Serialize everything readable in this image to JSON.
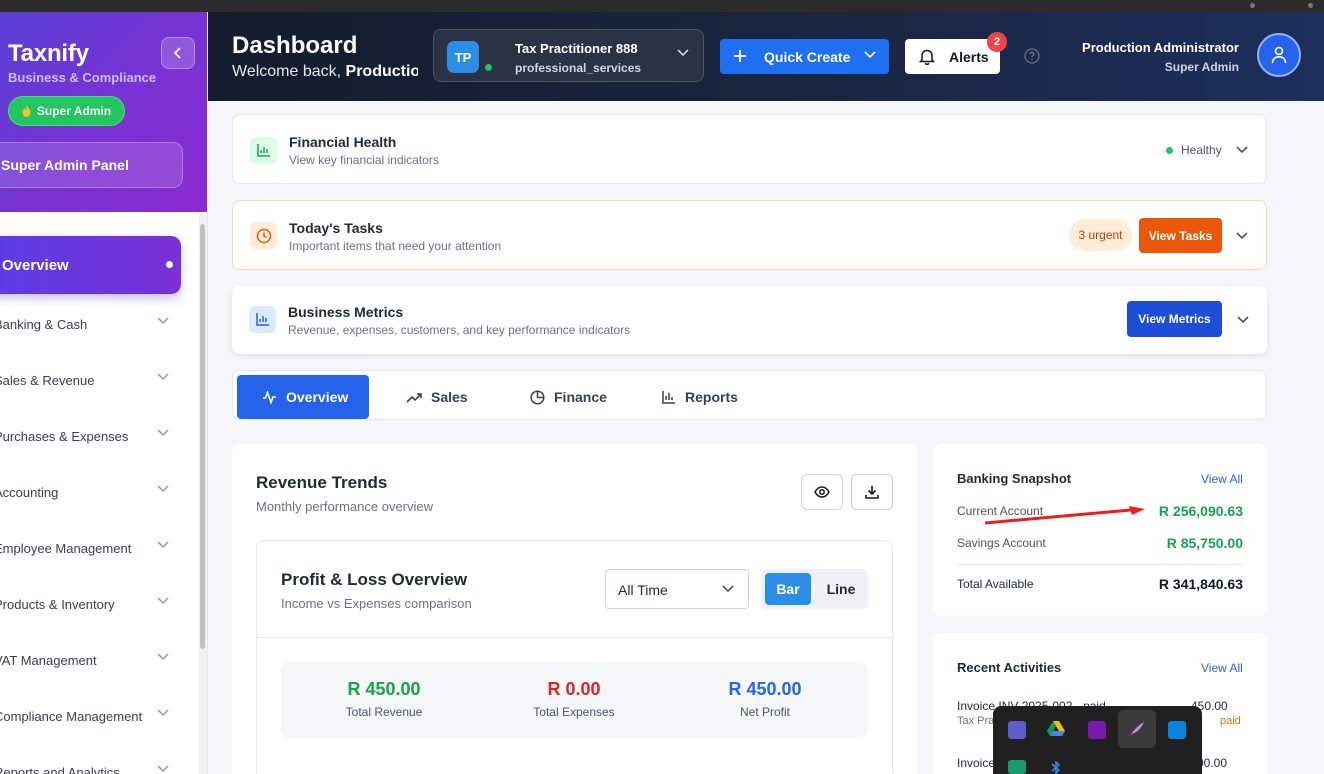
{
  "brand": {
    "name": "Taxnify",
    "subtitle": "Business & Compliance",
    "role_pill": "Super Admin",
    "panel": "Super Admin Panel"
  },
  "sidebar": {
    "active": "Overview",
    "items": [
      {
        "label": "Banking & Cash"
      },
      {
        "label": "Sales & Revenue"
      },
      {
        "label": "Purchases & Expenses"
      },
      {
        "label": "Accounting"
      },
      {
        "label": "Employee Management"
      },
      {
        "label": "Products & Inventory"
      },
      {
        "label": "VAT Management"
      },
      {
        "label": "Compliance Management"
      },
      {
        "label": "Reports and Analytics"
      }
    ]
  },
  "header": {
    "title": "Dashboard",
    "welcome_prefix": "Welcome back,",
    "welcome_name": "Production Administrator",
    "tenant": {
      "initials": "TP",
      "name": "Tax Practitioner 888",
      "type": "professional_services"
    },
    "quick_create": "Quick Create",
    "alerts": {
      "label": "Alerts",
      "count": "2"
    },
    "user": {
      "name": "Production Administrator",
      "role": "Super Admin"
    }
  },
  "sections": [
    {
      "title": "Financial Health",
      "subtitle": "View key financial indicators",
      "status": "Healthy"
    },
    {
      "title": "Today's Tasks",
      "subtitle": "Important items that need your attention",
      "badge": "3 urgent",
      "action": "View Tasks"
    },
    {
      "title": "Business Metrics",
      "subtitle": "Revenue, expenses, customers, and key performance indicators",
      "action": "View Metrics"
    }
  ],
  "tabs": [
    "Overview",
    "Sales",
    "Finance",
    "Reports"
  ],
  "revenue": {
    "title": "Revenue Trends",
    "subtitle": "Monthly performance overview",
    "pl": {
      "title": "Profit & Loss Overview",
      "subtitle": "Income vs Expenses comparison",
      "period": "All Time",
      "toggle": [
        "Bar",
        "Line"
      ],
      "stats": [
        {
          "value": "R 450.00",
          "label": "Total Revenue",
          "color": "#16a34a"
        },
        {
          "value": "R 0.00",
          "label": "Total Expenses",
          "color": "#dc2626"
        },
        {
          "value": "R 450.00",
          "label": "Net Profit",
          "color": "#2563eb"
        }
      ]
    }
  },
  "banking": {
    "title": "Banking Snapshot",
    "view_all": "View All",
    "accounts": [
      {
        "name": "Current Account",
        "amount": "R 256,090.63"
      },
      {
        "name": "Savings Account",
        "amount": "R 85,750.00"
      }
    ],
    "total_label": "Total Available",
    "total": "R 341,840.63"
  },
  "activities": {
    "title": "Recent Activities",
    "view_all": "View All",
    "items": [
      {
        "title": "Invoice INV-2025-002 - paid",
        "meta": "Tax Pra",
        "amount": "450.00",
        "status": "paid"
      },
      {
        "title": "Invoice",
        "amount": "00.00"
      }
    ]
  },
  "colors": {
    "accent": "#2563eb",
    "brand_purple": "#6d35d9",
    "success": "#16a34a",
    "warning": "#ea580c",
    "danger": "#dc2626",
    "header_dark": "#141b2d"
  }
}
